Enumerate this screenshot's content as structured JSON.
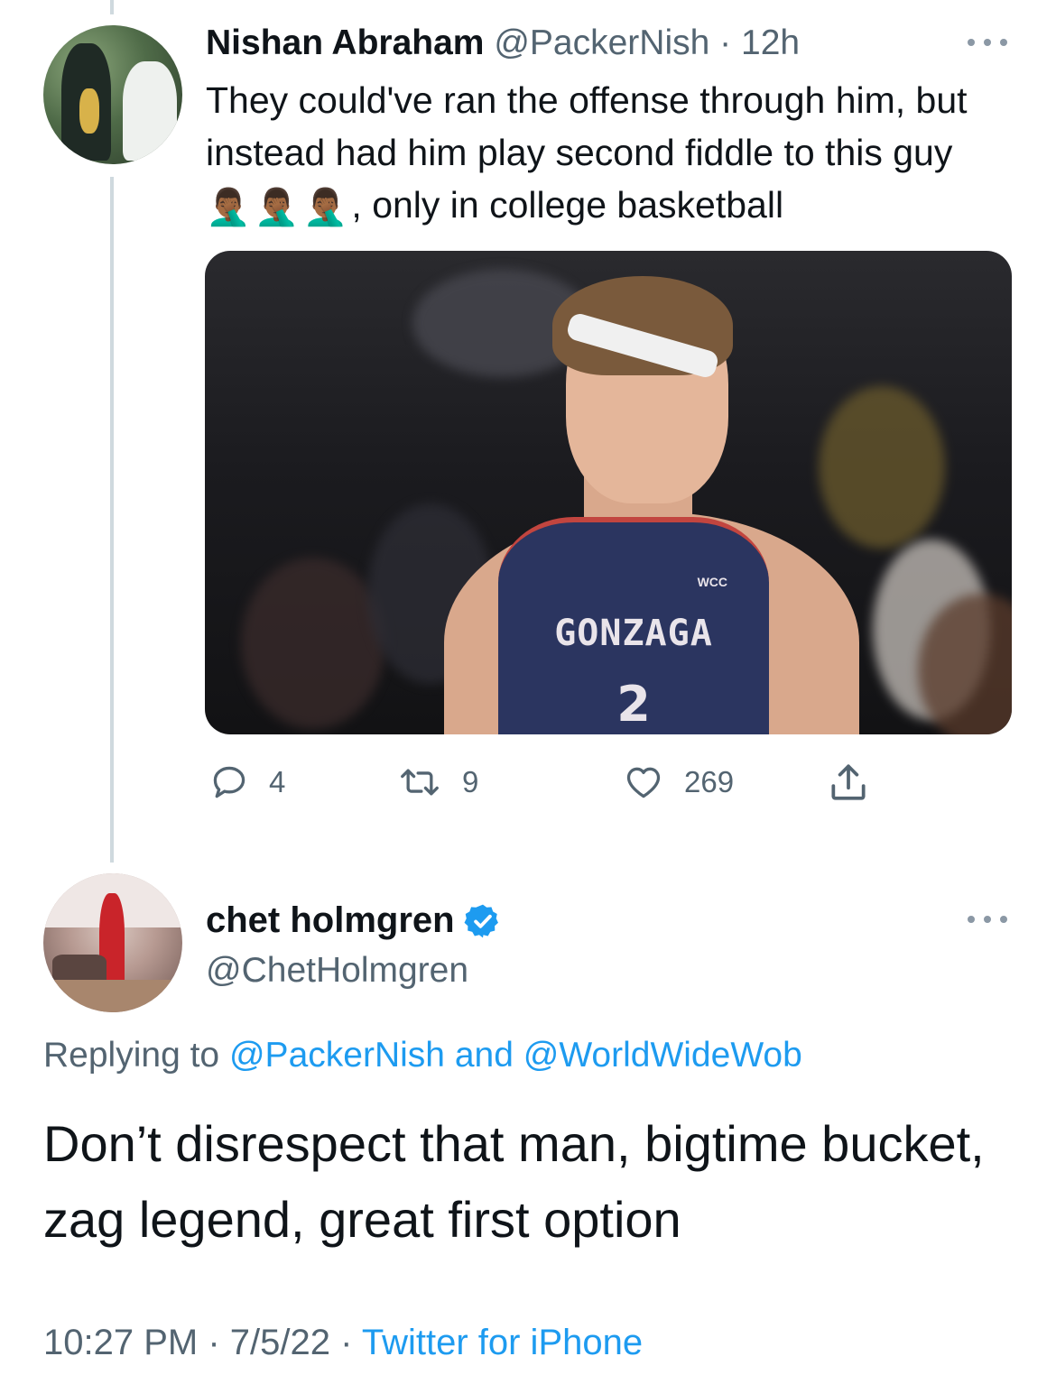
{
  "tweet1": {
    "name": "Nishan Abraham",
    "handle": "@PackerNish",
    "separator": "·",
    "time": "12h",
    "text_before_emoji": "They could've ran the offense through him, but instead had him play second fiddle to this guy",
    "emoji": "🤦🏾‍♂️🤦🏾‍♂️🤦🏾‍♂️",
    "text_after_emoji": ", only in college basketball",
    "media": {
      "jersey_text": "GONZAGA",
      "jersey_number": "2",
      "jersey_logo": "WCC"
    },
    "actions": {
      "replies": "4",
      "retweets": "9",
      "likes": "269"
    }
  },
  "tweet2": {
    "name": "chet holmgren",
    "handle": "@ChetHolmgren",
    "replying_label": "Replying to",
    "replying_user1": "@PackerNish",
    "replying_and": "and",
    "replying_user2": "@WorldWideWob",
    "text": "Don’t disrespect that man, bigtime bucket, zag legend, great first option",
    "time": "10:27 PM",
    "date": "7/5/22",
    "separator": "·",
    "source": "Twitter for iPhone"
  },
  "icons": {
    "more": "more-horizontal-icon",
    "reply": "reply-icon",
    "retweet": "retweet-icon",
    "like": "heart-icon",
    "share": "share-icon",
    "verified": "verified-badge-icon"
  },
  "colors": {
    "text": "#0f1419",
    "secondary": "#536471",
    "link": "#1d9bf0",
    "thread_line": "#cfd9de"
  }
}
